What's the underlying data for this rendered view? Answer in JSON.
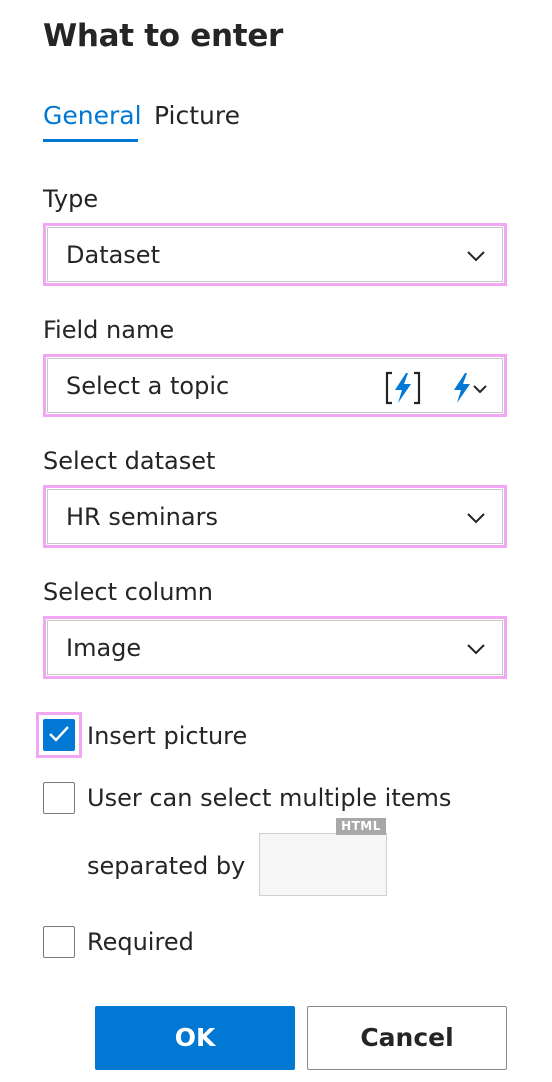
{
  "dialog": {
    "title": "What to enter"
  },
  "tabs": [
    {
      "label": "General",
      "active": true
    },
    {
      "label": "Picture",
      "active": false
    }
  ],
  "type_field": {
    "label": "Type",
    "value": "Dataset"
  },
  "field_name": {
    "label": "Field name",
    "placeholder": "Select a topic",
    "icons": [
      "bracket-lightning-icon",
      "lightning-dropdown-icon"
    ]
  },
  "dataset_field": {
    "label": "Select dataset",
    "value": "HR seminars"
  },
  "column_field": {
    "label": "Select column",
    "value": "Image"
  },
  "options": {
    "insert_picture": {
      "label": "Insert picture",
      "checked": true
    },
    "multiple_items": {
      "label": "User can select multiple items",
      "checked": false
    },
    "separated_by_label": "separated by",
    "separator_badge": "HTML",
    "separator_value": "",
    "required": {
      "label": "Required",
      "checked": false
    }
  },
  "buttons": {
    "ok": "OK",
    "cancel": "Cancel"
  },
  "colors": {
    "accent": "#0078d4",
    "focus": "#f2a7f2",
    "text": "#252525"
  }
}
